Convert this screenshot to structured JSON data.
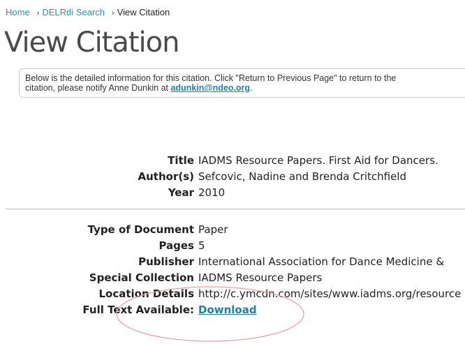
{
  "breadcrumb": {
    "home": "Home",
    "search": "DELRdi Search",
    "separator": "›",
    "current": "View Citation"
  },
  "page_title": "View Citation",
  "notice": {
    "line1": "Below is the detailed information for this citation. Click \"Return to Previous Page\" to return to the",
    "line2_prefix": "citation, please notify Anne Dunkin at ",
    "email": "adunkin@ndeo.org",
    "line2_suffix": "."
  },
  "citation": {
    "title_label": "Title",
    "title_value": "IADMS Resource Papers. First Aid for Dancers.",
    "authors_label": "Author(s)",
    "authors_value": "Sefcovic, Nadine and Brenda Critchfield",
    "year_label": "Year",
    "year_value": "2010"
  },
  "details": {
    "type_label": "Type of Document",
    "type_value": "Paper",
    "pages_label": "Pages",
    "pages_value": "5",
    "publisher_label": "Publisher",
    "publisher_value": "International Association for Dance Medicine &",
    "collection_label": "Special Collection",
    "collection_value": "IADMS Resource Papers",
    "location_label": "Location Details",
    "location_value": "http://c.ymcdn.com/sites/www.iadms.org/resource",
    "fulltext_label": "Full Text Available:",
    "fulltext_value": "Download"
  },
  "colors": {
    "link": "#1f7fa8",
    "annotation": "#e8a0a0"
  }
}
